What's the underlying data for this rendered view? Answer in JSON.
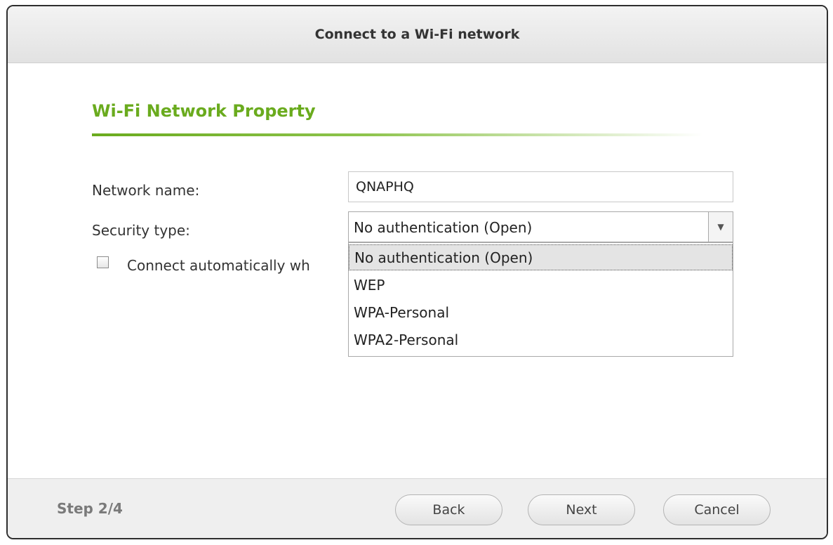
{
  "dialog": {
    "title": "Connect to a Wi-Fi network"
  },
  "section": {
    "title": "Wi-Fi Network Property"
  },
  "form": {
    "network_name_label": "Network name:",
    "network_name_value": "QNAPHQ",
    "security_type_label": "Security type:",
    "security_type_value": "No authentication (Open)",
    "security_options": [
      "No authentication (Open)",
      "WEP",
      "WPA-Personal",
      "WPA2-Personal"
    ],
    "auto_connect_label": "Connect automatically wh",
    "auto_connect_checked": false
  },
  "footer": {
    "step": "Step 2/4",
    "back_label": "Back",
    "next_label": "Next",
    "cancel_label": "Cancel"
  },
  "colors": {
    "accent": "#6aab1e",
    "border": "#2e2e2e"
  },
  "icons": {
    "dropdown": "chevron-down-icon"
  }
}
